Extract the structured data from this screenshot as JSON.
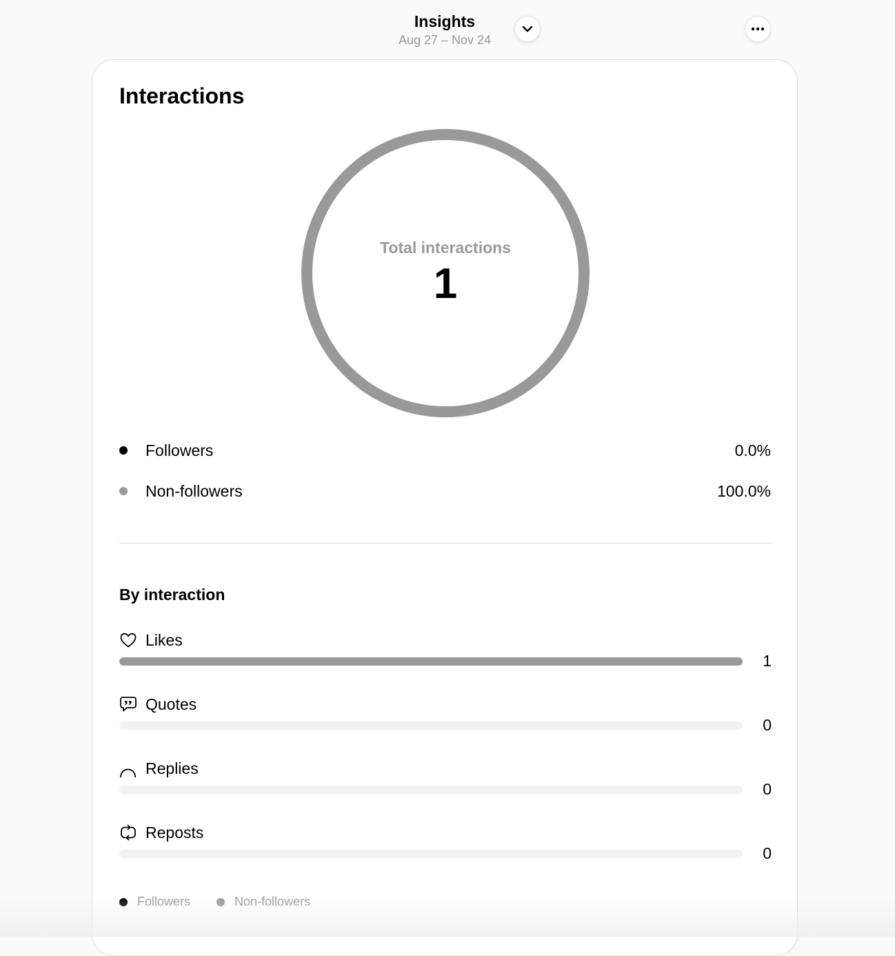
{
  "header": {
    "title": "Insights",
    "date_range": "Aug 27 – Nov 24",
    "dropdown_icon": "chevron-down-icon",
    "more_icon": "more-horizontal-icon"
  },
  "card": {
    "title": "Interactions",
    "donut": {
      "label": "Total interactions",
      "value": "1",
      "segments": [
        {
          "name": "Followers",
          "fraction": 0.0,
          "color": "#000000"
        },
        {
          "name": "Non-followers",
          "fraction": 1.0,
          "color": "#999999"
        }
      ]
    },
    "audience": [
      {
        "label": "Followers",
        "value": "0.0%",
        "color": "#000000"
      },
      {
        "label": "Non-followers",
        "value": "100.0%",
        "color": "#999999"
      }
    ],
    "by_interaction": {
      "title": "By interaction",
      "items": [
        {
          "label": "Likes",
          "icon": "heart-icon",
          "value": "1",
          "fraction": 1.0
        },
        {
          "label": "Quotes",
          "icon": "quote-bubble-icon",
          "value": "0",
          "fraction": 0.0
        },
        {
          "label": "Replies",
          "icon": "reply-bubble-icon",
          "value": "0",
          "fraction": 0.0
        },
        {
          "label": "Reposts",
          "icon": "repost-icon",
          "value": "0",
          "fraction": 0.0
        }
      ]
    },
    "legend": [
      {
        "label": "Followers",
        "color": "#000000"
      },
      {
        "label": "Non-followers",
        "color": "#999999"
      }
    ]
  },
  "colors": {
    "bar_fill": "#999999",
    "bar_track": "#f2f2f2",
    "muted_text": "#999999"
  }
}
